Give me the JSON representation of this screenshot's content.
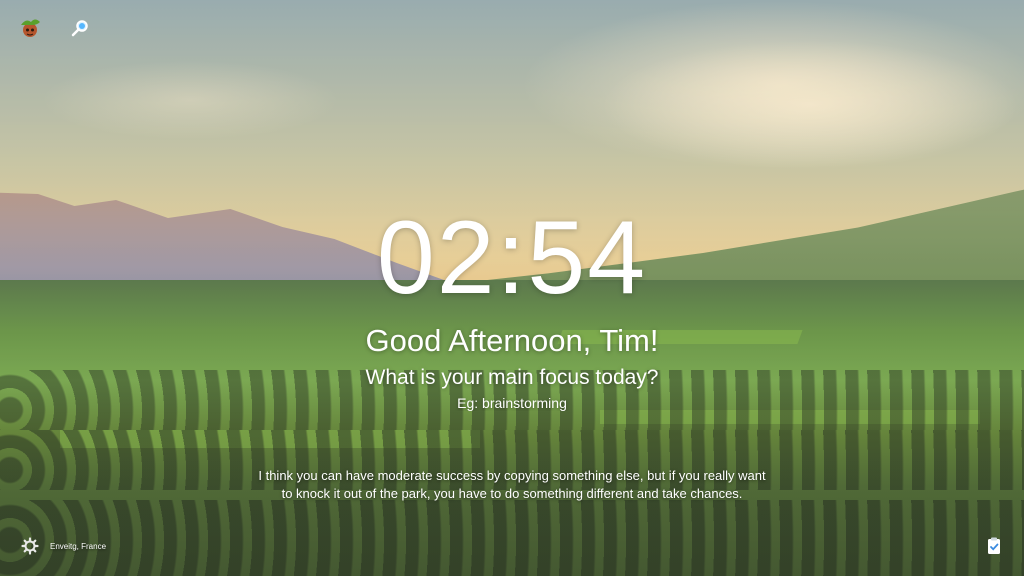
{
  "clock": {
    "time": "02:54"
  },
  "greeting": {
    "text": "Good Afternoon, Tim!"
  },
  "focus": {
    "question": "What is your main focus today?",
    "placeholder": "Eg: brainstorming"
  },
  "quote": {
    "text": "I think you can have moderate success by copying something else, but if you really want to knock it out of the park, you have to do something different and take chances."
  },
  "background": {
    "location": "Enveitg, France"
  },
  "icons": {
    "top_left": [
      "profile-avatar-icon",
      "search-icon"
    ],
    "bottom_left": "settings-gear-icon",
    "bottom_right": "todo-clipboard-icon"
  }
}
